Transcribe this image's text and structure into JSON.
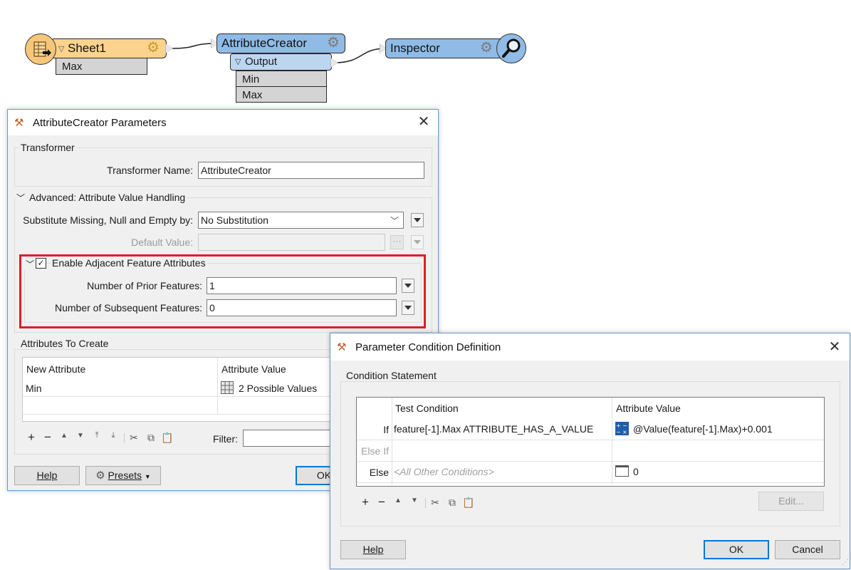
{
  "canvas": {
    "reader": {
      "label": "Sheet1",
      "attrs": [
        "Max"
      ]
    },
    "creator": {
      "label": "AttributeCreator",
      "port_label": "Output",
      "attrs": [
        "Min",
        "Max"
      ]
    },
    "inspector": {
      "label": "Inspector"
    }
  },
  "creator_dialog": {
    "title": "AttributeCreator Parameters",
    "transformer_group": "Transformer",
    "transformer_name_label": "Transformer Name:",
    "transformer_name_value": "AttributeCreator",
    "advanced_group": "Advanced: Attribute Value Handling",
    "substitute_label": "Substitute Missing, Null and Empty by:",
    "substitute_value": "No Substitution",
    "default_value_label": "Default Value:",
    "default_value_value": "",
    "adjacent_label": "Enable Adjacent Feature Attributes",
    "adjacent_checked": true,
    "prior_label": "Number of Prior Features:",
    "prior_value": "1",
    "subsequent_label": "Number of Subsequent Features:",
    "subsequent_value": "0",
    "attributes_group": "Attributes To Create",
    "columns": [
      "New Attribute",
      "Attribute Value"
    ],
    "rows": [
      {
        "name": "Min",
        "value": "2 Possible Values"
      }
    ],
    "filter_label": "Filter:",
    "help_label": "Help",
    "presets_label": "Presets",
    "ok_label": "OK",
    "highlight_color": "#d9202b"
  },
  "condition_dialog": {
    "title": "Parameter Condition Definition",
    "group_title": "Condition Statement",
    "columns": [
      "Test Condition",
      "Attribute Value"
    ],
    "rows": [
      {
        "kind": "If",
        "condition": "feature[-1].Max ATTRIBUTE_HAS_A_VALUE",
        "value": "@Value(feature[-1].Max)+0.001"
      },
      {
        "kind": "Else If",
        "condition": "",
        "value": ""
      },
      {
        "kind": "Else",
        "condition": "<All Other Conditions>",
        "value": "0"
      }
    ],
    "edit_label": "Edit...",
    "help_label": "Help",
    "ok_label": "OK",
    "cancel_label": "Cancel"
  },
  "colors": {
    "reader_fill": "#fbd38d",
    "transformer_fill": "#8fbbe6",
    "port_fill": "#bcd6f0",
    "accent_blue": "#0078d7"
  }
}
